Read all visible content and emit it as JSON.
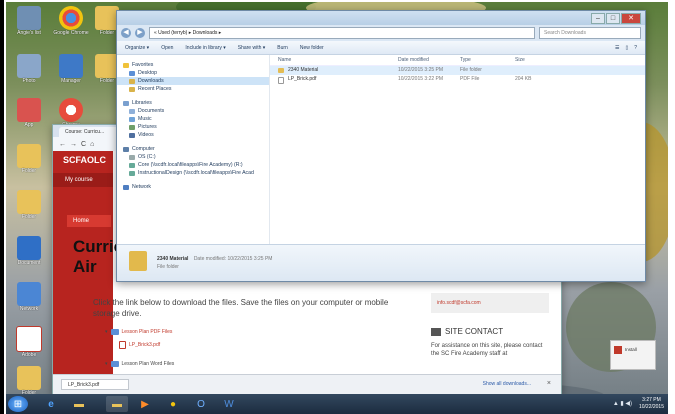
{
  "desktop": {
    "icons": [
      {
        "label": "Angie's list",
        "icon": "app-icon"
      },
      {
        "label": "Google Chrome",
        "icon": "chrome-icon"
      },
      {
        "label": "Folder",
        "icon": "folder-icon"
      },
      {
        "label": "Photo",
        "icon": "image-icon"
      },
      {
        "label": "Manager",
        "icon": "people-icon"
      },
      {
        "label": "Folder",
        "icon": "folder-icon"
      },
      {
        "label": "App",
        "icon": "app-icon"
      },
      {
        "label": "Chrome",
        "icon": "chrome-icon"
      },
      {
        "label": "Folder",
        "icon": "folder-icon"
      },
      {
        "label": "Folder",
        "icon": "folder-icon"
      },
      {
        "label": "Document",
        "icon": "doc-icon"
      },
      {
        "label": "Network",
        "icon": "network-icon"
      },
      {
        "label": "Adobe",
        "icon": "pdf-icon"
      },
      {
        "label": "Folder",
        "icon": "folder-icon"
      }
    ]
  },
  "explorer": {
    "address_path": "« Used (terryb) ▸ Downloads ▸",
    "search_placeholder": "Search Downloads",
    "toolbar": {
      "organize": "Organize ▾",
      "open": "Open",
      "include": "Include in library ▾",
      "share": "Share with ▾",
      "burn": "Burn",
      "new_folder": "New folder"
    },
    "nav": {
      "favorites": "Favorites",
      "desktop": "Desktop",
      "downloads": "Downloads",
      "recent": "Recent Places",
      "libraries": "Libraries",
      "documents": "Documents",
      "music": "Music",
      "pictures": "Pictures",
      "videos": "Videos",
      "computer": "Computer",
      "os": "OS (C:)",
      "core": "Core (\\\\scdfr.local\\fileapps\\Fire Academy) (R:)",
      "instructional": "InstructionalDesign (\\\\scdfr.local\\fileapps\\Fire Acad",
      "network": "Network"
    },
    "columns": {
      "name": "Name",
      "date": "Date modified",
      "type": "Type",
      "size": "Size"
    },
    "files": [
      {
        "name": "2340 Material",
        "date": "10/22/2015 3:25 PM",
        "type": "File folder",
        "size": ""
      },
      {
        "name": "LP_Brick.pdf",
        "date": "10/22/2015 3:22 PM",
        "type": "PDF File",
        "size": "204 KB"
      }
    ],
    "details": {
      "name": "2340 Material",
      "date_label": "Date modified: 10/22/2015 3:25 PM",
      "type": "File folder"
    }
  },
  "browser": {
    "tab_title": "Course: Curricu...",
    "site_name": "SCFAOLC",
    "my_courses": "My course",
    "home": "Home",
    "title_line1": "Curric",
    "title_line2": "Air",
    "instruction": "Click the link below to download the files. Save the files on your computer or mobile storage drive.",
    "list": {
      "pdf_files": "Lesson Plan PDF Files",
      "pdf_file": "LP_Brick3.pdf",
      "word_files": "Lesson Plan Word Files"
    },
    "email": "info.scdf@scfa.com",
    "site_contact": "SITE CONTACT",
    "contact_text": "For assistance on this site, please contact the SC Fire Academy staff at",
    "download_item": "LP_Brick3.pdf",
    "show_all": "Show all downloads...",
    "close": "×"
  },
  "notification": {
    "title": "Install"
  },
  "taskbar": {
    "time": "3:27 PM",
    "date": "10/22/2015"
  }
}
